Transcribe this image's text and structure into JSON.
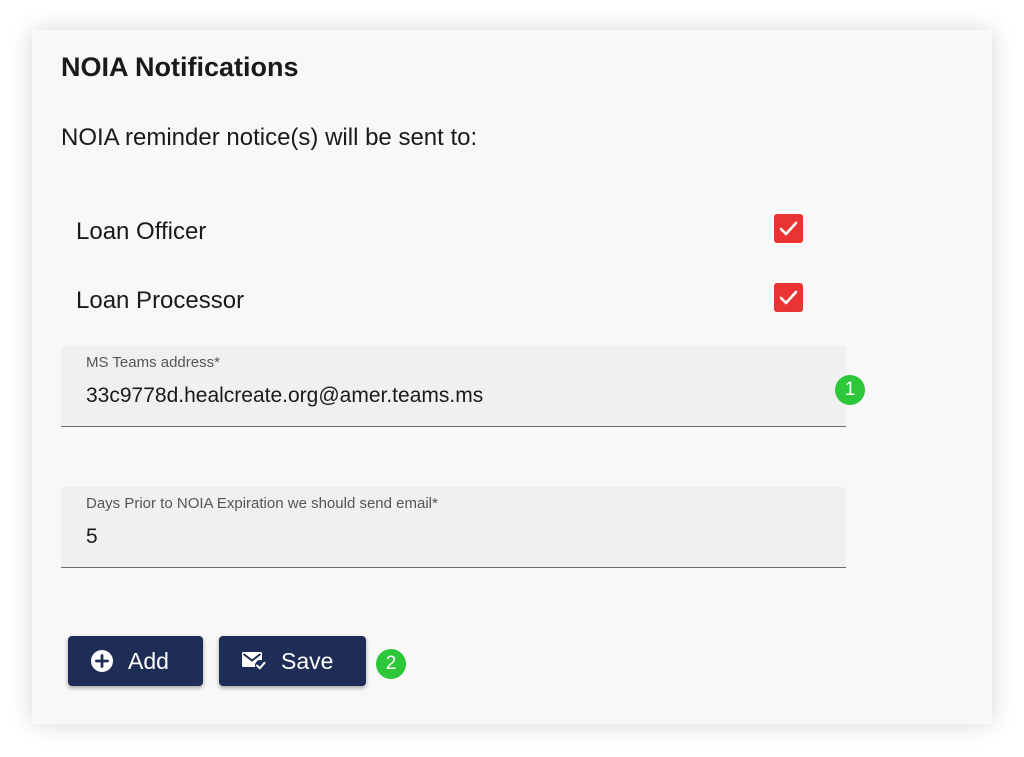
{
  "panel": {
    "title": "NOIA Notifications",
    "subtitle": "NOIA reminder notice(s) will be sent to:"
  },
  "recipients": [
    {
      "label": "Loan Officer",
      "checked": true
    },
    {
      "label": "Loan Processor",
      "checked": true
    }
  ],
  "fields": {
    "teams": {
      "label": "MS Teams address*",
      "value": "33c9778d.healcreate.org@amer.teams.ms"
    },
    "days": {
      "label": "Days Prior to NOIA Expiration we should send email*",
      "value": "5"
    }
  },
  "actions": {
    "add_label": "Add",
    "save_label": "Save"
  },
  "markers": {
    "one": "1",
    "two": "2"
  },
  "colors": {
    "checkbox": "#ea3434",
    "button": "#1e2d55",
    "marker": "#2dc83a",
    "card": "#f8f8f8",
    "field": "#f0f0f0"
  },
  "icons": {
    "add": "plus-circle-icon",
    "save": "mail-check-icon",
    "check": "check-icon"
  }
}
